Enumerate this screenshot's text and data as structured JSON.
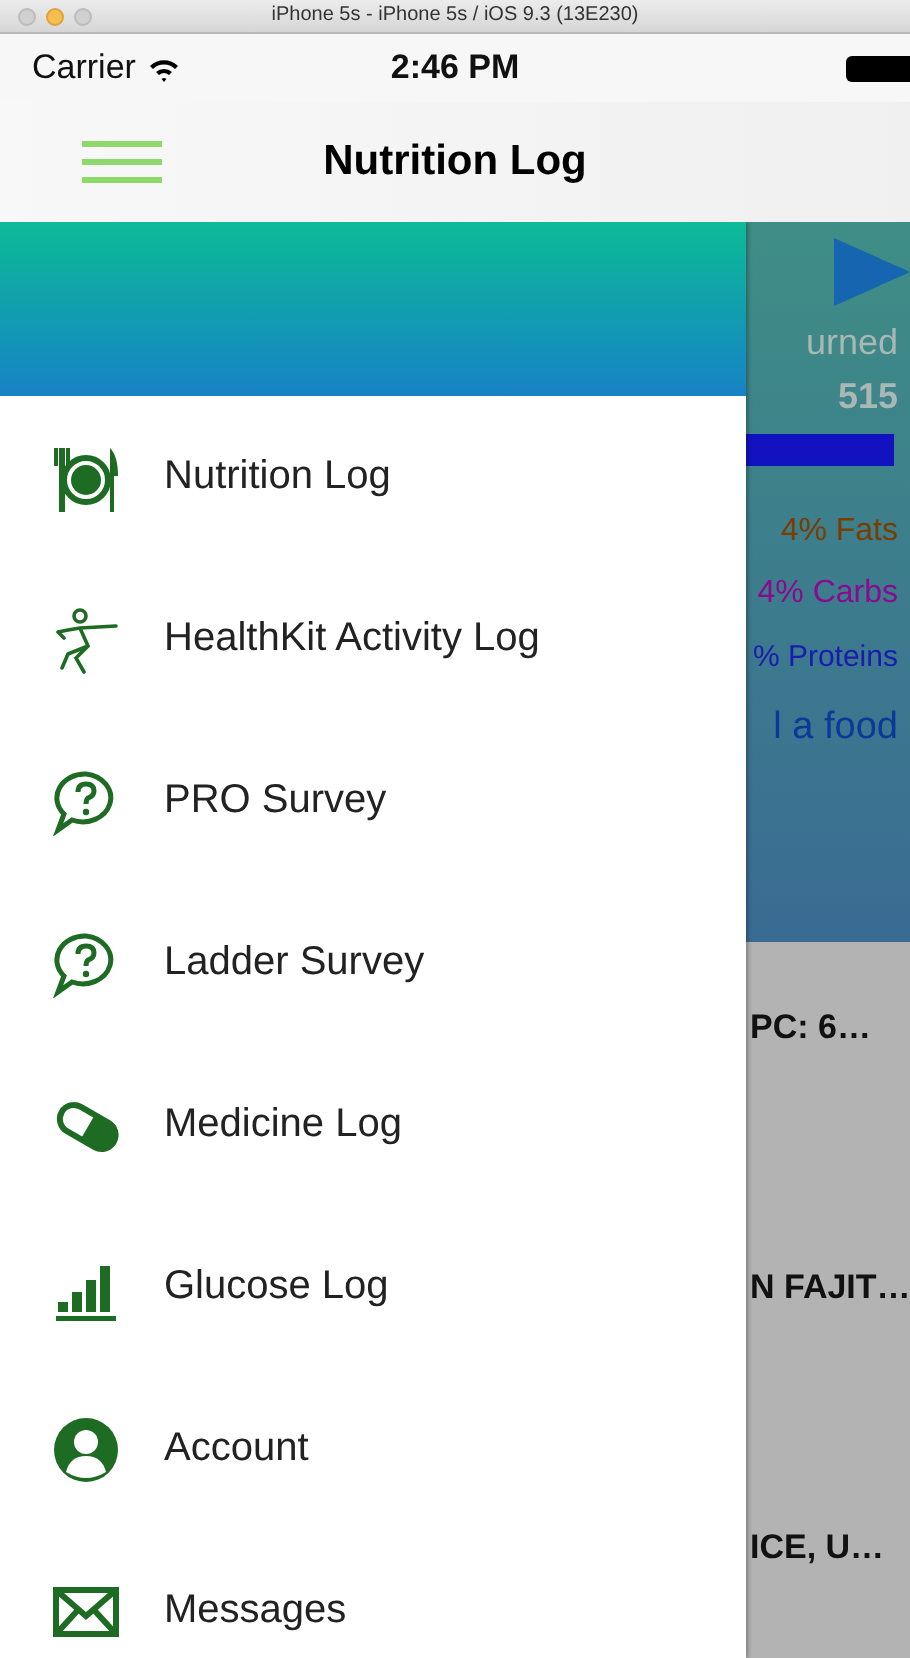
{
  "simulator": {
    "title": "iPhone 5s - iPhone 5s / iOS 9.3 (13E230)"
  },
  "status_bar": {
    "carrier": "Carrier",
    "time": "2:46 PM"
  },
  "nav_bar": {
    "title": "Nutrition Log"
  },
  "menu": {
    "items": [
      {
        "label": "Nutrition Log"
      },
      {
        "label": "HealthKit Activity Log"
      },
      {
        "label": "PRO Survey"
      },
      {
        "label": "Ladder Survey"
      },
      {
        "label": "Medicine Log"
      },
      {
        "label": "Glucose Log"
      },
      {
        "label": "Account"
      },
      {
        "label": "Messages"
      }
    ]
  },
  "background_screen": {
    "burned_label": "urned",
    "burned_value": "515",
    "fats": "4% Fats",
    "carbs": "4% Carbs",
    "proteins": "% Proteins",
    "add_food": "l a food",
    "entries": [
      "PC: 6…",
      "N FAJIT…",
      "ICE, U…"
    ]
  }
}
